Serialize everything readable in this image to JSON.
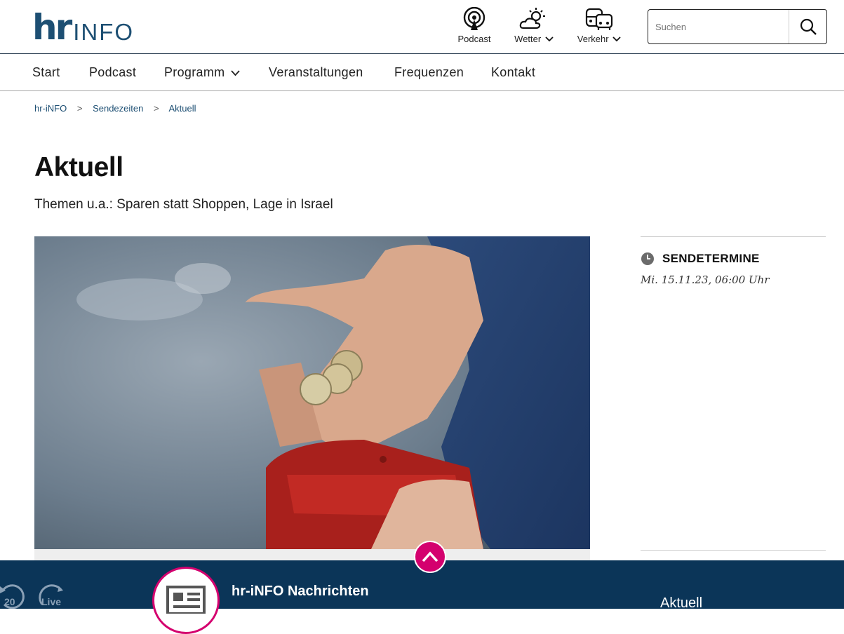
{
  "brand": {
    "hr": "hr",
    "info": "INFO"
  },
  "services": [
    {
      "label": "Podcast",
      "icon": "podcast-icon"
    },
    {
      "label": "Wetter",
      "icon": "weather-icon"
    },
    {
      "label": "Verkehr",
      "icon": "traffic-icon"
    }
  ],
  "search": {
    "placeholder": "Suchen"
  },
  "nav": [
    "Start",
    "Podcast",
    "Programm",
    "Veranstaltungen",
    "Frequenzen",
    "Kontakt"
  ],
  "breadcrumb": [
    "hr-iNFO",
    "Sendezeiten",
    "Aktuell"
  ],
  "breadcrumb_sep": ">",
  "page": {
    "title": "Aktuell",
    "subtitle": "Themen u.a.: Sparen statt Shoppen, Lage in Israel"
  },
  "sidebar": {
    "heading": "SENDETERMINE",
    "date": "Mi. 15.11.23, 06:00 Uhr"
  },
  "player": {
    "title": "hr-iNFO Nachrichten",
    "now": "Aktuell",
    "skip": "20",
    "live": "Live"
  },
  "colors": {
    "brand": "#1d4f73",
    "player_bg": "#0b3558",
    "accent": "#d4006e"
  }
}
